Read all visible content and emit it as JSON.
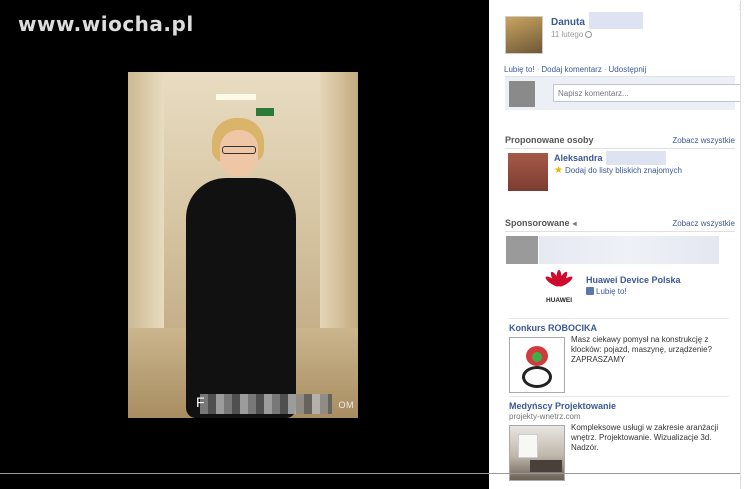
{
  "watermark": "www.wiocha.pl",
  "photo": {
    "blur_start": "F",
    "blur_end": "OM"
  },
  "panel": {
    "close": "×",
    "author": {
      "name": "Danuta",
      "date": "11 lutego"
    },
    "actions": {
      "like": "Lubię to!",
      "comment": "Dodaj komentarz",
      "share": "Udostępnij"
    },
    "comment_placeholder": "Napisz komentarz...",
    "suggested": {
      "title": "Proponowane osoby",
      "see_all": "Zobacz wszystkie",
      "person_name": "Aleksandra",
      "person_action": "Dodaj do listy bliskich znajomych"
    },
    "sponsored": {
      "title": "Sponsorowane",
      "see_all": "Zobacz wszystkie",
      "huawei": {
        "logo_text": "HUAWEI",
        "name": "Huawei Device Polska",
        "like": "Lubię to!"
      },
      "ads": [
        {
          "title": "Konkurs ROBOCIKA",
          "text": "Masz ciekawy pomysł na konstrukcję z klocków: pojazd, maszynę, urządzenie? ZAPRASZAMY"
        },
        {
          "title": "Medyńscy Projektowanie",
          "domain": "projekty-wnetrz.com",
          "text": "Kompleksowe usługi w zakresie aranżacji wnętrz. Projektowanie. Wizualizacje 3d. Nadzór."
        }
      ]
    }
  },
  "colors": {
    "link": "#3b5998",
    "huawei_red": "#cf0a2c"
  }
}
